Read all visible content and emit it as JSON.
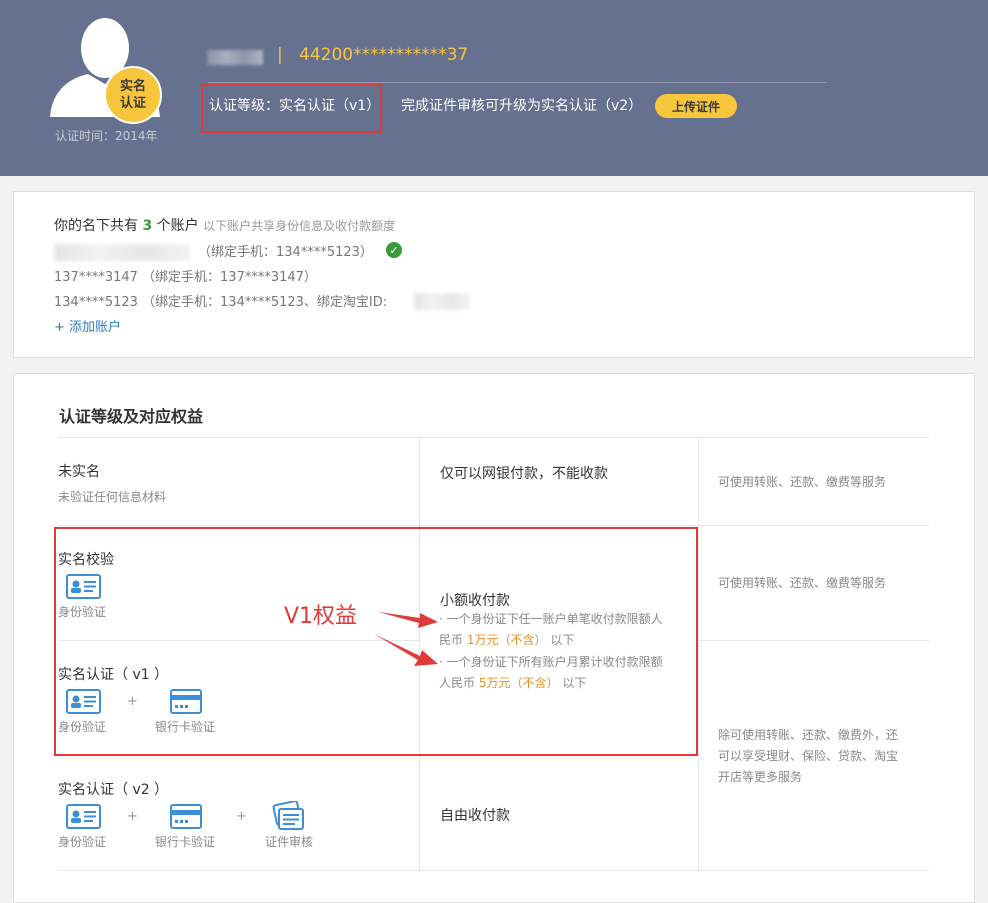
{
  "header": {
    "badge_line1": "实名",
    "badge_line2": "认证",
    "cert_time": "认证时间：2014年",
    "separator": "|",
    "id_number": "44200***********37",
    "level_text": "认证等级：实名认证（v1）",
    "upgrade_text": "完成证件审核可升级为实名认证（v2）",
    "upload_button": "上传证件"
  },
  "accounts": {
    "title_prefix": "你的名下共有",
    "count": "3",
    "title_suffix": "个账户",
    "subtitle": "以下账户共享身份信息及收付款额度",
    "rows": [
      {
        "text": "（绑定手机：134****5123）"
      },
      {
        "text": "137****3147 （绑定手机：137****3147）"
      },
      {
        "text": "134****5123 （绑定手机：134****5123、绑定淘宝ID:"
      }
    ],
    "add_account": "+ 添加账户"
  },
  "levels": {
    "title": "认证等级及对应权益",
    "rows": [
      {
        "name": "未实名",
        "sub": "未验证任何信息材料",
        "capability": "仅可以网银付款，不能收款",
        "perks": "可使用转账、还款、缴费等服务"
      },
      {
        "name": "实名校验",
        "capability": "小额收付款",
        "perks": "可使用转账、还款、缴费等服务"
      },
      {
        "name": "实名认证（ v1 ）"
      },
      {
        "name": "实名认证（ v2 ）",
        "capability": "自由收付款",
        "perks_line1": "除可使用转账、还款、缴费外，还",
        "perks_line2": "可以享受理财、保险、贷款、淘宝",
        "perks_line3": "开店等更多服务"
      }
    ],
    "small_pay_note1_line1": "· 一个身份证下任一账户单笔收付款限额人",
    "small_pay_note1_pre": "民币",
    "small_pay_note1_amount": "1万元（不含）",
    "small_pay_note1_post": "以下",
    "small_pay_note2_line1": "· 一个身份证下所有账户月累计收付款限额",
    "small_pay_note2_pre": "人民币",
    "small_pay_note2_amount": "5万元（不含）",
    "small_pay_note2_post": "以下",
    "icon_labels": {
      "id": "身份验证",
      "bank": "银行卡验证",
      "doc": "证件审核"
    },
    "plus": "+"
  },
  "annotation": {
    "v1_label": "V1权益"
  },
  "colors": {
    "header_bg": "#65718f",
    "accent_yellow": "#f8c63d",
    "annotation_red": "#e03a3a",
    "amount_orange": "#e8901c",
    "link_blue": "#2e7bbf",
    "check_green": "#3c9a3c"
  }
}
